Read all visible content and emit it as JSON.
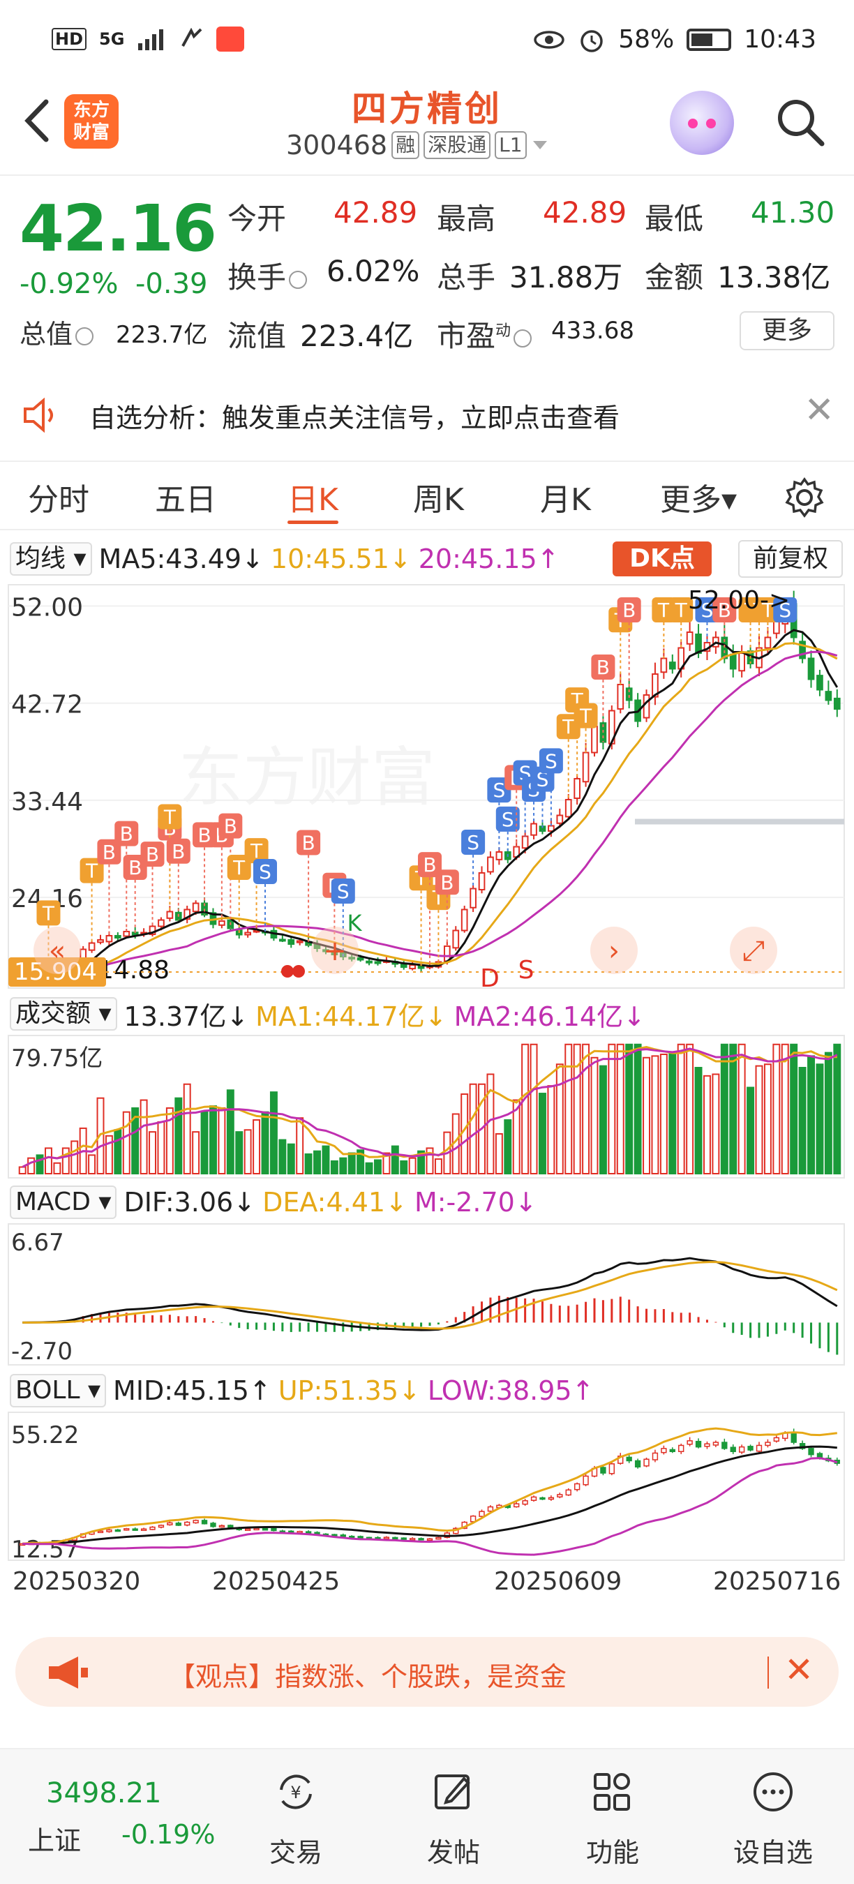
{
  "status_bar": {
    "net_label": "HD",
    "signal_label": "5G",
    "battery_pct": "58%",
    "time": "10:43"
  },
  "header": {
    "logo_text_line1": "东方",
    "logo_text_line2": "财富",
    "stock_name": "四方精创",
    "stock_code": "300468",
    "tag_margin": "融",
    "tag_connect": "深股通",
    "tag_level": "L1"
  },
  "quote": {
    "price": "42.16",
    "change_pct": "-0.92%",
    "change_abs": "-0.39",
    "open_label": "今开",
    "open": "42.89",
    "high_label": "最高",
    "high": "42.89",
    "low_label": "最低",
    "low": "41.30",
    "turnover_label": "换手",
    "turnover": "6.02%",
    "volume_label": "总手",
    "volume": "31.88万",
    "amount_label": "金额",
    "amount": "13.38亿",
    "mktcap_label": "总值",
    "mktcap": "223.7亿",
    "float_label": "流值",
    "float_cap": "223.4亿",
    "pe_label": "市盈",
    "pe_sup": "动",
    "pe": "433.68",
    "more_label": "更多"
  },
  "notice": {
    "text": "自选分析：触发重点关注信号，立即点击查看"
  },
  "tabs": [
    "分时",
    "五日",
    "日K",
    "周K",
    "月K",
    "更多▾"
  ],
  "active_tab": "日K",
  "ma_row": {
    "selector": "均线",
    "ma5": "MA5:43.49↓",
    "ma10": "10:45.51↓",
    "ma20": "20:45.15↑",
    "dk_button": "DK点",
    "adjust_button": "前复权"
  },
  "vol_row": {
    "selector": "成交额",
    "value": "13.37亿↓",
    "ma1": "MA1:44.17亿↓",
    "ma2": "MA2:46.14亿↓"
  },
  "macd_row": {
    "selector": "MACD",
    "dif": "DIF:3.06↓",
    "dea": "DEA:4.41↓",
    "m": "M:-2.70↓"
  },
  "boll_row": {
    "selector": "BOLL",
    "mid": "MID:45.15↑",
    "up": "UP:51.35↓",
    "low": "LOW:38.95↑"
  },
  "chart_data": [
    {
      "type": "candlestick",
      "title": "日K",
      "y_ticks": [
        "52.00",
        "42.72",
        "33.44",
        "24.16"
      ],
      "ylim": [
        15.9,
        53.5
      ],
      "annotations": [
        "52.00->",
        "14.88",
        "15.904",
        "D",
        "S",
        "K"
      ],
      "x_ticks": [
        "20250320",
        "20250425",
        "20250609",
        "20250716"
      ],
      "approx_close_series": [
        16.0,
        16.2,
        16.1,
        16.3,
        16.5,
        17.2,
        18.0,
        19.2,
        19.8,
        20.1,
        20.5,
        20.3,
        20.9,
        20.6,
        20.8,
        21.4,
        22.0,
        22.8,
        22.0,
        23.0,
        23.6,
        22.5,
        21.6,
        21.9,
        21.2,
        20.6,
        20.8,
        21.0,
        20.9,
        20.3,
        20.1,
        19.7,
        20.0,
        19.6,
        19.3,
        19.0,
        18.7,
        18.5,
        18.3,
        18.2,
        18.0,
        17.9,
        18.1,
        17.8,
        17.5,
        17.7,
        17.4,
        17.6,
        18.0,
        19.5,
        21.0,
        23.0,
        25.0,
        26.5,
        28.0,
        28.5,
        27.8,
        29.0,
        30.0,
        31.2,
        30.5,
        31.0,
        32.0,
        33.5,
        35.5,
        38.0,
        40.5,
        39.0,
        42.0,
        44.5,
        43.0,
        41.0,
        43.5,
        45.5,
        47.0,
        46.0,
        48.0,
        49.5,
        47.5,
        48.5,
        49.0,
        47.0,
        46.0,
        47.5,
        46.5,
        48.0,
        49.0,
        50.5,
        52.0,
        49.0,
        47.0,
        45.0,
        44.0,
        43.0,
        42.16
      ]
    },
    {
      "type": "bar",
      "title": "成交额",
      "y_ticks": [
        "79.75亿"
      ],
      "ylim": [
        0,
        80
      ]
    },
    {
      "type": "line",
      "title": "MACD",
      "y_ticks": [
        "6.67",
        "-2.70"
      ],
      "ylim": [
        -3.0,
        7.5
      ]
    },
    {
      "type": "line",
      "title": "BOLL",
      "y_ticks": [
        "55.22",
        "12.57"
      ],
      "ylim": [
        12.0,
        56.5
      ]
    }
  ],
  "banner": {
    "text": "【观点】指数涨、个股跌，是资金"
  },
  "bottom_nav": {
    "index_value": "3498.21",
    "index_name": "上证",
    "index_pct": "-0.19%",
    "items": [
      "交易",
      "发帖",
      "功能",
      "设自选"
    ]
  }
}
